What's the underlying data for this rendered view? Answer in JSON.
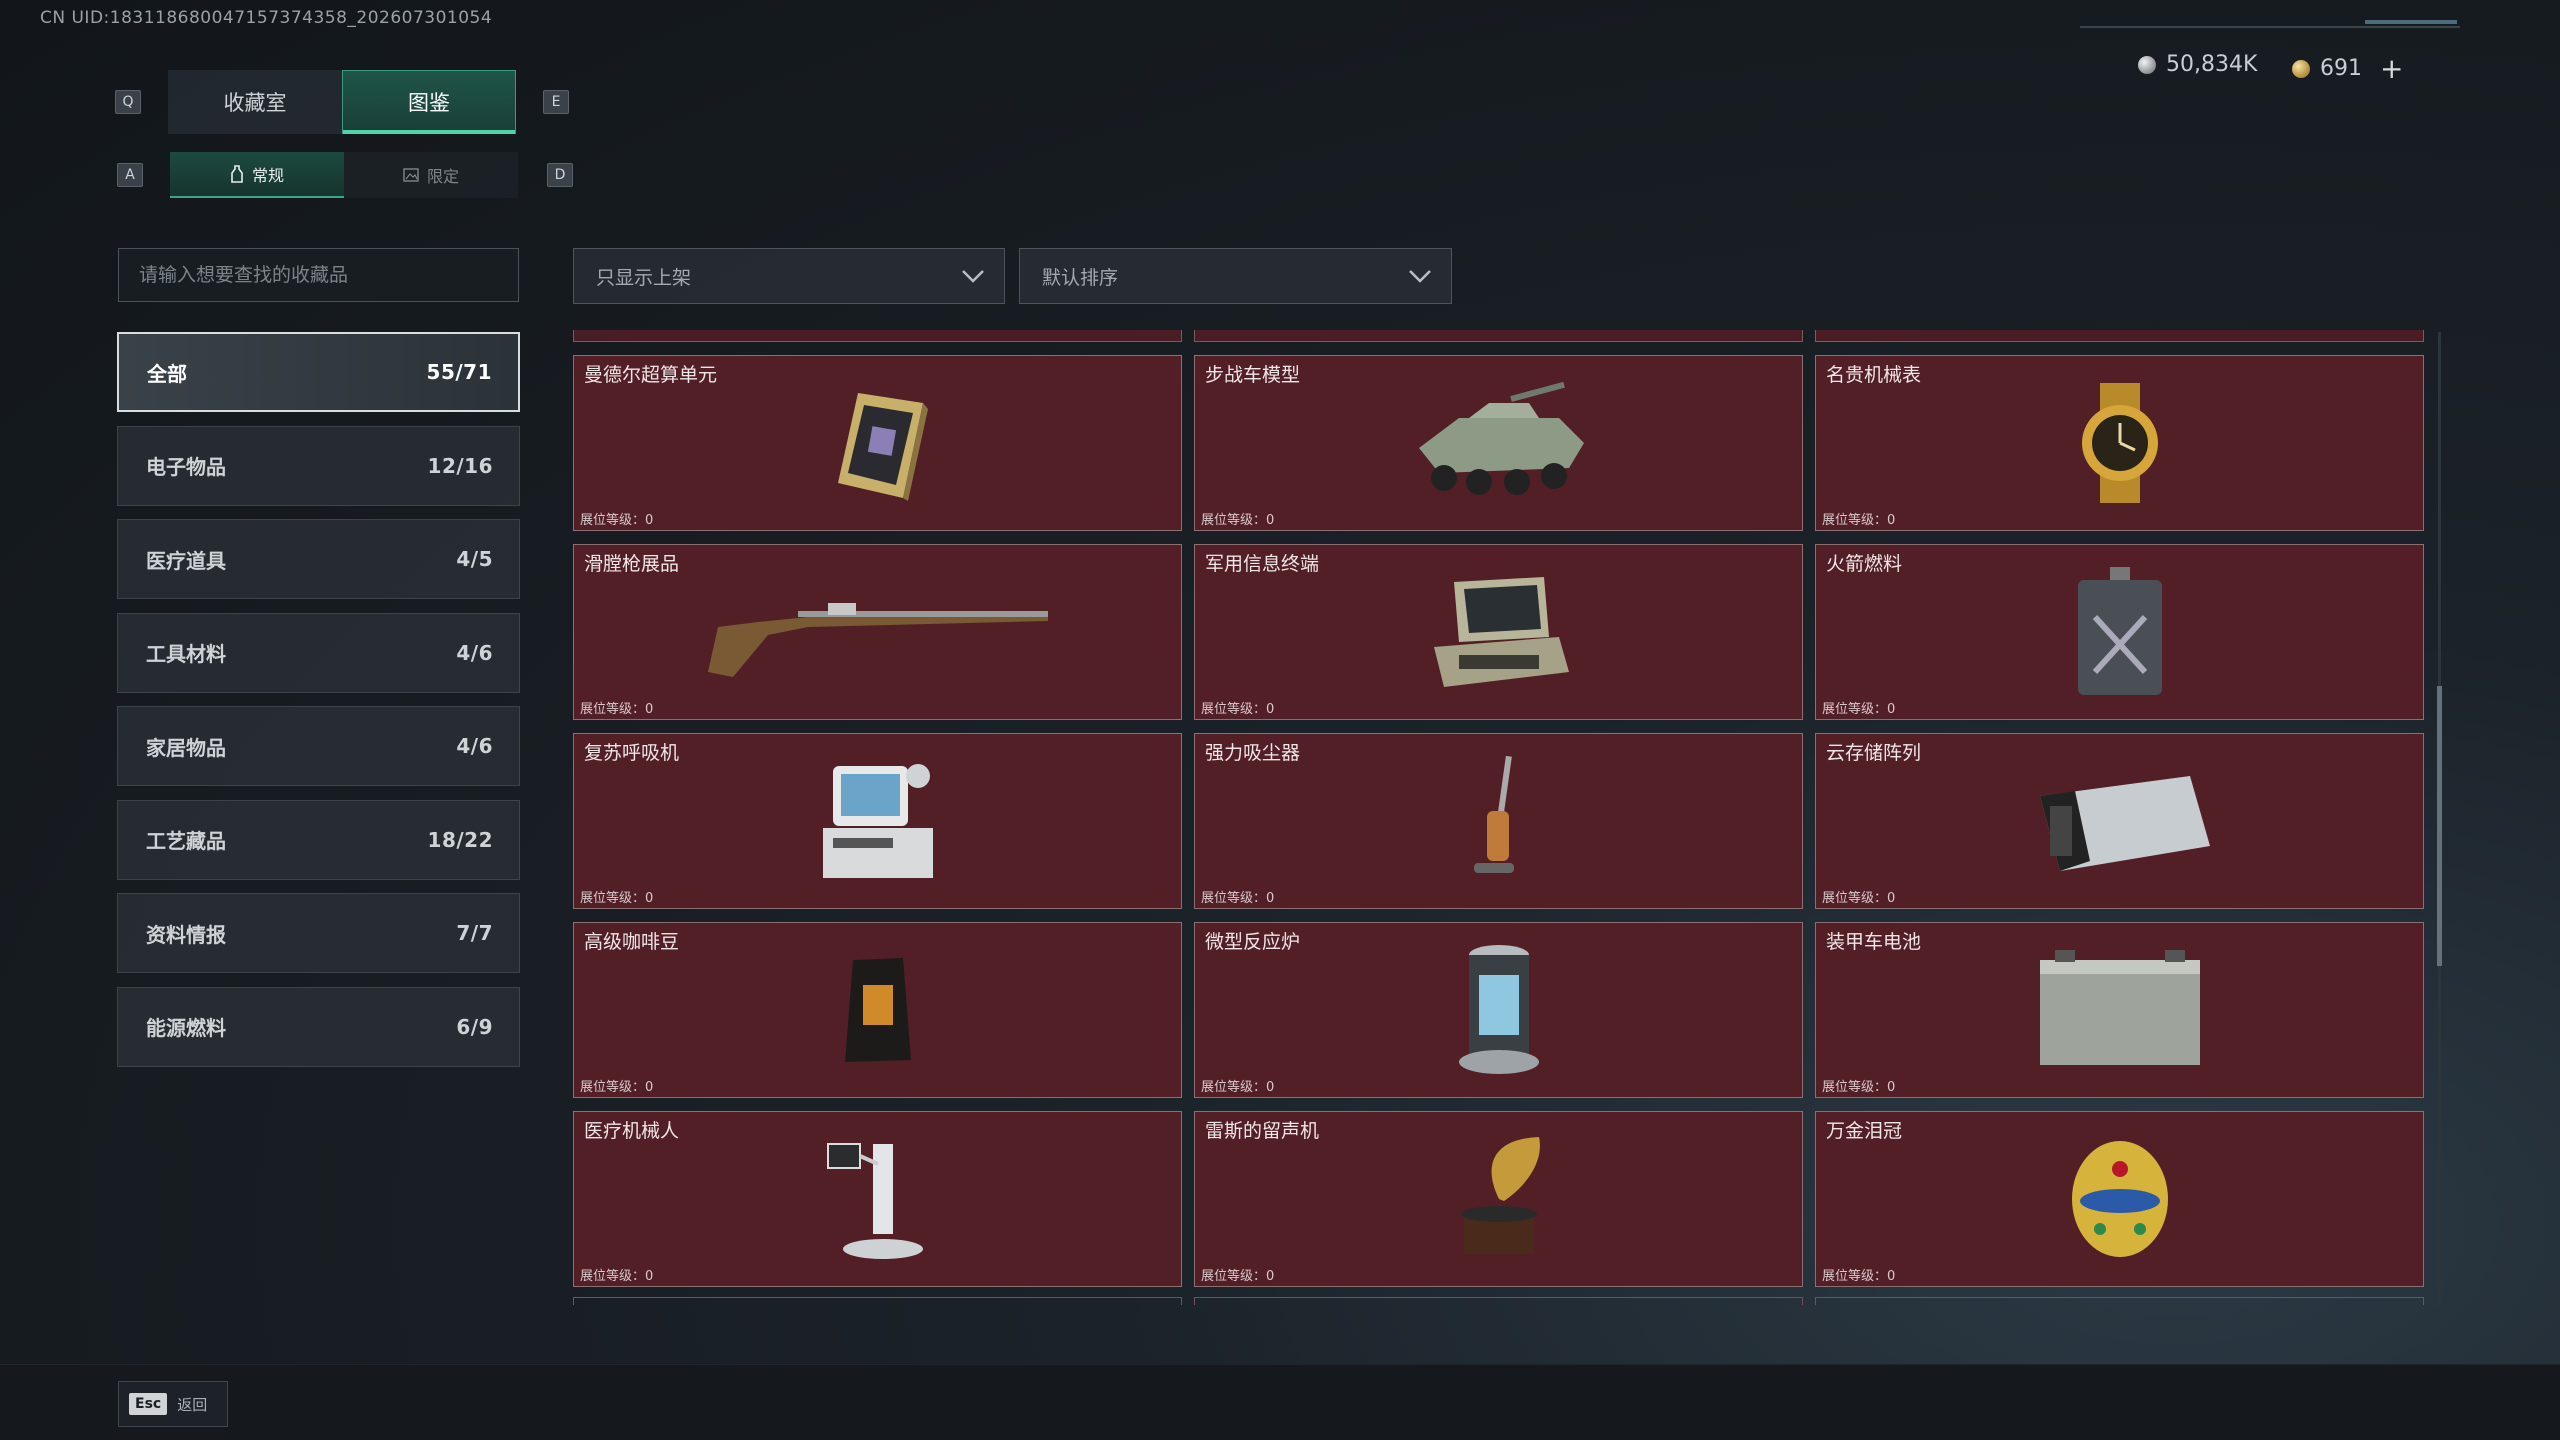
{
  "uid_text": "CN UID:183118680047157374358_202607301054",
  "keys": {
    "left_tab": "Q",
    "right_tab": "E",
    "left_sub": "A",
    "right_sub": "D"
  },
  "tabs": [
    {
      "label": "收藏室"
    },
    {
      "label": "图鉴"
    }
  ],
  "subtabs": [
    {
      "label": "常规"
    },
    {
      "label": "限定"
    }
  ],
  "currency": {
    "silver": "50,834K",
    "gold": "691",
    "plus": "+"
  },
  "search": {
    "placeholder": "请输入想要查找的收藏品"
  },
  "filters": {
    "shelf": "只显示上架",
    "sort": "默认排序"
  },
  "categories": [
    {
      "label": "全部",
      "count": "55/71"
    },
    {
      "label": "电子物品",
      "count": "12/16"
    },
    {
      "label": "医疗道具",
      "count": "4/5"
    },
    {
      "label": "工具材料",
      "count": "4/6"
    },
    {
      "label": "家居物品",
      "count": "4/6"
    },
    {
      "label": "工艺藏品",
      "count": "18/22"
    },
    {
      "label": "资料情报",
      "count": "7/7"
    },
    {
      "label": "能源燃料",
      "count": "6/9"
    }
  ],
  "items": [
    {
      "name": "曼德尔超算单元",
      "level": "展位等级：0",
      "icon": "supercomputer-unit-icon"
    },
    {
      "name": "步战车模型",
      "level": "展位等级：0",
      "icon": "ifv-model-icon"
    },
    {
      "name": "名贵机械表",
      "level": "展位等级：0",
      "icon": "luxury-watch-icon"
    },
    {
      "name": "滑膛枪展品",
      "level": "展位等级：0",
      "icon": "musket-icon"
    },
    {
      "name": "军用信息终端",
      "level": "展位等级：0",
      "icon": "military-terminal-icon"
    },
    {
      "name": "火箭燃料",
      "level": "展位等级：0",
      "icon": "rocket-fuel-icon"
    },
    {
      "name": "复苏呼吸机",
      "level": "展位等级：0",
      "icon": "ventilator-icon"
    },
    {
      "name": "强力吸尘器",
      "level": "展位等级：0",
      "icon": "vacuum-cleaner-icon"
    },
    {
      "name": "云存储阵列",
      "level": "展位等级：0",
      "icon": "cloud-storage-icon"
    },
    {
      "name": "高级咖啡豆",
      "level": "展位等级：0",
      "icon": "coffee-beans-icon"
    },
    {
      "name": "微型反应炉",
      "level": "展位等级：0",
      "icon": "micro-reactor-icon"
    },
    {
      "name": "装甲车电池",
      "level": "展位等级：0",
      "icon": "vehicle-battery-icon"
    },
    {
      "name": "医疗机械人",
      "level": "展位等级：0",
      "icon": "medical-robot-icon"
    },
    {
      "name": "雷斯的留声机",
      "level": "展位等级：0",
      "icon": "gramophone-icon"
    },
    {
      "name": "万金泪冠",
      "level": "展位等级：0",
      "icon": "jeweled-egg-icon"
    }
  ],
  "partial_top_label": "展位等级：0",
  "footer": {
    "esc_key": "Esc",
    "back_label": "返回"
  },
  "colors": {
    "card_bg": "#521f27",
    "accent_green": "#4fd3a7"
  }
}
